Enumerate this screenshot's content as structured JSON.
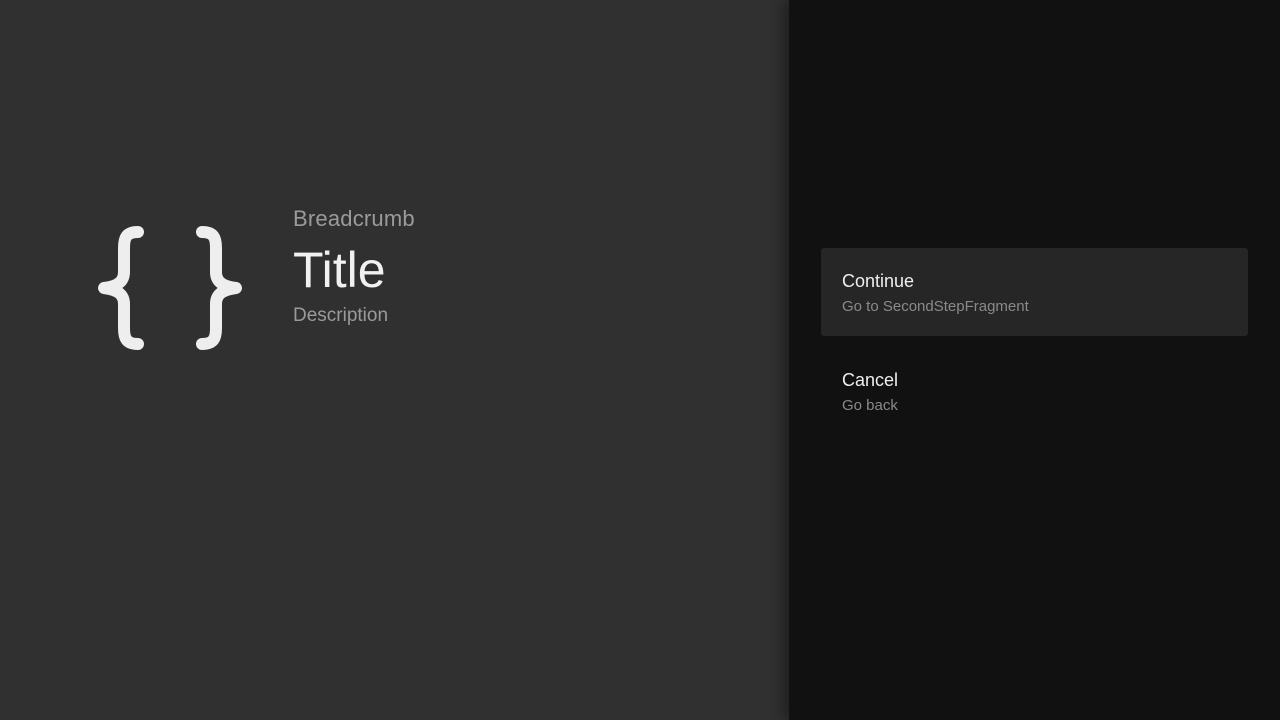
{
  "guidance": {
    "icon": "curly-braces-icon",
    "breadcrumb": "Breadcrumb",
    "title": "Title",
    "description": "Description"
  },
  "actions": [
    {
      "title": "Continue",
      "description": "Go to SecondStepFragment",
      "focused": true
    },
    {
      "title": "Cancel",
      "description": "Go back",
      "focused": false
    }
  ],
  "colors": {
    "guidance_background": "#303030",
    "actions_background": "#111111",
    "focused_action_background": "#262626",
    "primary_text": "#eeeeee",
    "secondary_text": "#9a9a9a"
  }
}
